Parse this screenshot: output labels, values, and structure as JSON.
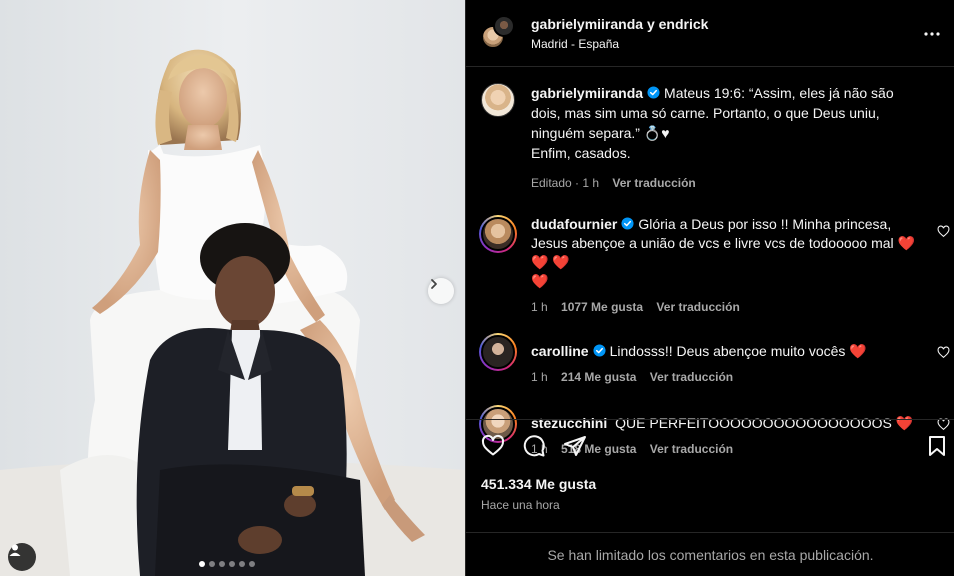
{
  "post": {
    "header_user": "gabrielymiiranda",
    "header_connector": "y",
    "header_collab": "endrick",
    "location": "Madrid - España"
  },
  "caption": {
    "username": "gabrielymiiranda",
    "text": "Mateus 19:6: “Assim, eles já não são dois, mas sim uma só carne. Portanto, o que Deus uniu, ninguém separa.” 💍♥",
    "text2": "Enfim, casados.",
    "edited": "Editado · 1 h",
    "translate": "Ver traducción"
  },
  "comments": [
    {
      "username": "dudafournier",
      "text": "Glória a Deus por isso !! Minha princesa, Jesus abençoe a união de vcs e livre vcs de todooooo mal",
      "hearts": "❤️ ❤️ ❤️",
      "hearts2": "❤️",
      "time": "1 h",
      "likes": "1077 Me gusta",
      "translate": "Ver traducción"
    },
    {
      "username": "carolline",
      "text": "Lindosss!! Deus abençoe muito vocês",
      "hearts": "❤️",
      "time": "1 h",
      "likes": "214 Me gusta",
      "translate": "Ver traducción"
    },
    {
      "username": "stezucchini",
      "text": "QUE PERFEITOOOOOOOOOOOOOOOOS",
      "hearts": "❤️",
      "time": "1 h",
      "likes": "518 Me gusta",
      "translate": "Ver traducción"
    }
  ],
  "stats": {
    "likes": "451.334 Me gusta",
    "posted": "Hace una hora"
  },
  "footer": {
    "comments_limited": "Se han limitado los comentarios en esta publicación."
  },
  "carousel": {
    "count": 6,
    "active": 1
  },
  "colors": {
    "accent_verified": "#0095f6",
    "heart_red": "#ff3040",
    "background": "#000000"
  }
}
